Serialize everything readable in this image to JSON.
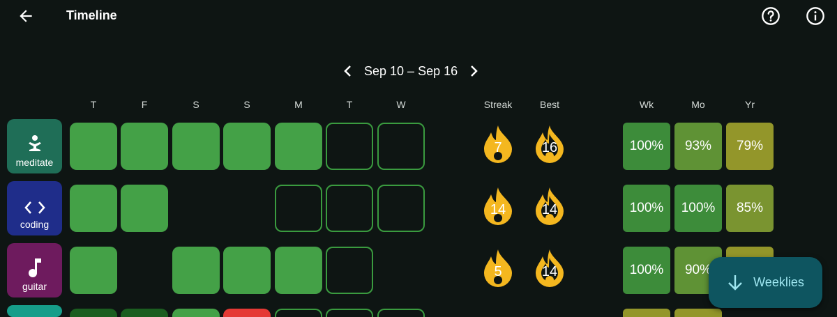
{
  "app": {
    "title": "Timeline"
  },
  "week": {
    "range": "Sep 10 – Sep 16"
  },
  "day_headers": [
    "T",
    "F",
    "S",
    "S",
    "M",
    "T",
    "W"
  ],
  "stat_headers": {
    "streak": "Streak",
    "best": "Best"
  },
  "pct_headers": {
    "wk": "Wk",
    "mo": "Mo",
    "yr": "Yr"
  },
  "habits": [
    {
      "label": "meditate",
      "icon": "meditation-icon",
      "color": "#1f6e57",
      "streak": "7",
      "best": "16",
      "wk": "100%",
      "mo": "93%",
      "yr": "79%"
    },
    {
      "label": "coding",
      "icon": "code-icon",
      "color": "#1f2d8a",
      "streak": "14",
      "best": "14",
      "wk": "100%",
      "mo": "100%",
      "yr": "85%"
    },
    {
      "label": "guitar",
      "icon": "music-note-icon",
      "color": "#6e1b5e",
      "streak": "5",
      "best": "14",
      "wk": "100%",
      "mo": "90%",
      "yr": ""
    }
  ],
  "fab": {
    "label": "Weeklies"
  },
  "colors": {
    "done": "#44a147",
    "todo_border": "#3a9b3f",
    "flame": "#f4b71f",
    "fab_bg": "#0e5560"
  }
}
